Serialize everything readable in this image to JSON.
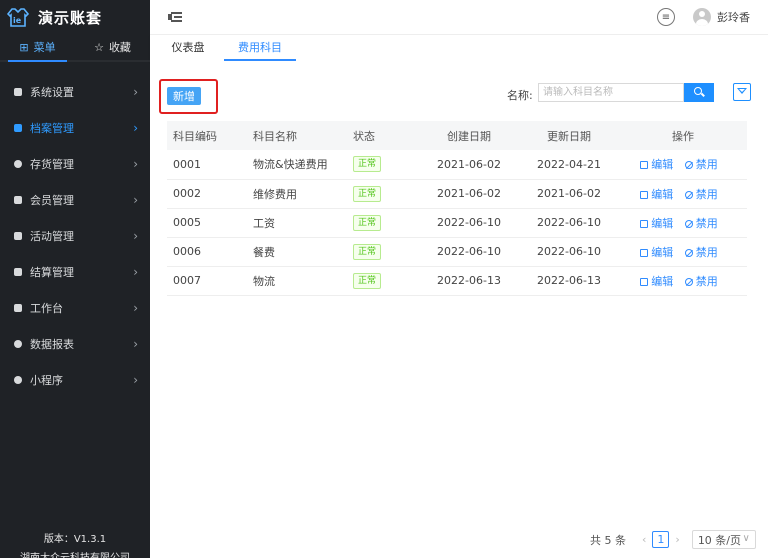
{
  "app": {
    "name": "演示账套"
  },
  "sidebar": {
    "tabs": [
      {
        "label": "菜单",
        "active": true
      },
      {
        "label": "收藏",
        "active": false
      }
    ],
    "items": [
      {
        "label": "系统设置"
      },
      {
        "label": "档案管理",
        "active": true
      },
      {
        "label": "存货管理"
      },
      {
        "label": "会员管理"
      },
      {
        "label": "活动管理"
      },
      {
        "label": "结算管理"
      },
      {
        "label": "工作台"
      },
      {
        "label": "数据报表"
      },
      {
        "label": "小程序"
      }
    ],
    "footer": {
      "version": "版本：V1.3.1",
      "company": "湖南太众云科技有限公司"
    }
  },
  "header": {
    "username": "彭玲香"
  },
  "tabs": [
    {
      "label": "仪表盘",
      "active": false
    },
    {
      "label": "费用科目",
      "active": true
    }
  ],
  "toolbar": {
    "add_label": "新增",
    "search_label": "名称:",
    "search_placeholder": "请输入科目名称"
  },
  "table": {
    "columns": [
      "科目编码",
      "科目名称",
      "状态",
      "创建日期",
      "更新日期",
      "操作"
    ],
    "rows": [
      {
        "code": "0001",
        "name": "物流&快递费用",
        "status": "正常",
        "created": "2021-06-02",
        "updated": "2022-04-21"
      },
      {
        "code": "0002",
        "name": "维修费用",
        "status": "正常",
        "created": "2021-06-02",
        "updated": "2021-06-02"
      },
      {
        "code": "0005",
        "name": "工资",
        "status": "正常",
        "created": "2022-06-10",
        "updated": "2022-06-10"
      },
      {
        "code": "0006",
        "name": "餐费",
        "status": "正常",
        "created": "2022-06-10",
        "updated": "2022-06-10"
      },
      {
        "code": "0007",
        "name": "物流",
        "status": "正常",
        "created": "2022-06-13",
        "updated": "2022-06-13"
      }
    ],
    "actions": {
      "edit": "编辑",
      "disable": "禁用"
    }
  },
  "pagination": {
    "total": "共 5 条",
    "current": "1",
    "page_size": "10 条/页"
  },
  "colors": {
    "accent": "#2f8bff",
    "sidebar_bg": "#1f2226",
    "highlight_border": "#e02020",
    "status_green": "#52c41a"
  }
}
